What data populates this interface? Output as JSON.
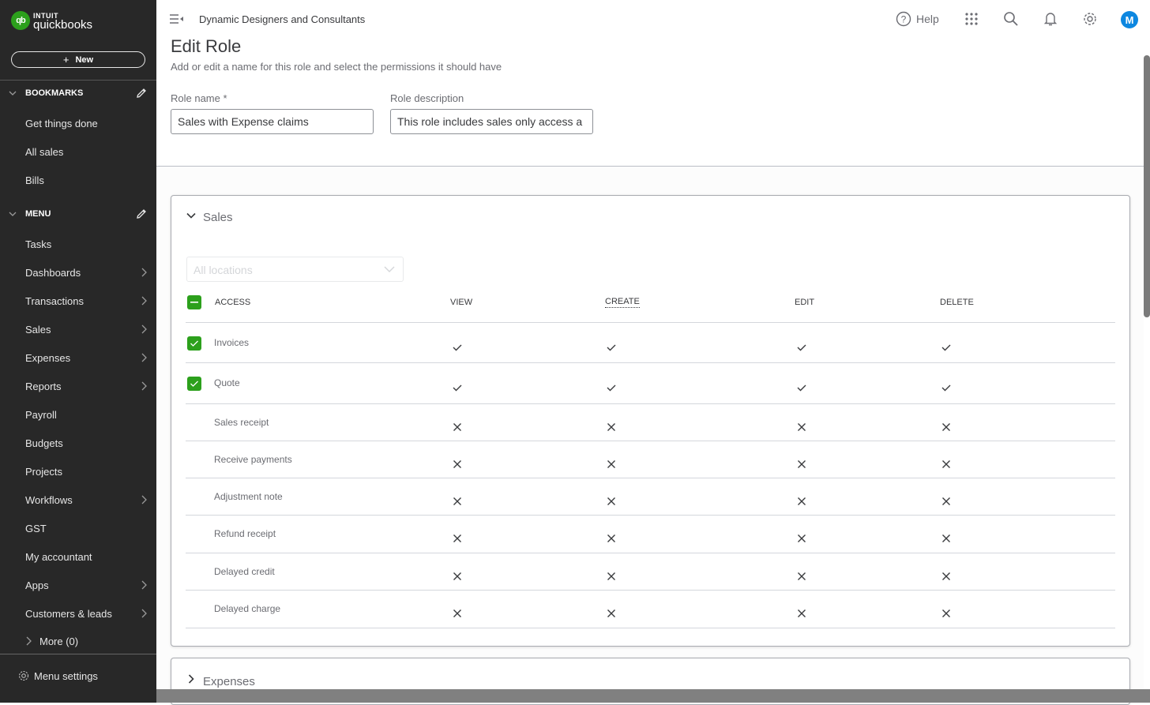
{
  "brand": {
    "intuit": "INTUIT",
    "product": "quickbooks",
    "badge": "qb",
    "color": "#2ca01c"
  },
  "sidebar": {
    "new_label": "New",
    "bookmarks_title": "BOOKMARKS",
    "bookmarks": [
      {
        "label": "Get things done"
      },
      {
        "label": "All sales"
      },
      {
        "label": "Bills"
      }
    ],
    "menu_title": "MENU",
    "menu": [
      {
        "label": "Tasks",
        "has_arrow": false
      },
      {
        "label": "Dashboards",
        "has_arrow": true
      },
      {
        "label": "Transactions",
        "has_arrow": true
      },
      {
        "label": "Sales",
        "has_arrow": true
      },
      {
        "label": "Expenses",
        "has_arrow": true
      },
      {
        "label": "Reports",
        "has_arrow": true
      },
      {
        "label": "Payroll",
        "has_arrow": false
      },
      {
        "label": "Budgets",
        "has_arrow": false
      },
      {
        "label": "Projects",
        "has_arrow": false
      },
      {
        "label": "Workflows",
        "has_arrow": true
      },
      {
        "label": "GST",
        "has_arrow": false
      },
      {
        "label": "My accountant",
        "has_arrow": false
      },
      {
        "label": "Apps",
        "has_arrow": true
      },
      {
        "label": "Customers & leads",
        "has_arrow": true
      }
    ],
    "more_label": "More (0)",
    "menu_settings_label": "Menu settings"
  },
  "topbar": {
    "company": "Dynamic Designers and Consultants",
    "help_label": "Help",
    "avatar_initial": "M",
    "avatar_color": "#0d87e0"
  },
  "page": {
    "title": "Edit Role",
    "subtitle": "Add or edit a name for this role and select the permissions it should have",
    "role_name_label": "Role name *",
    "role_name_value": "Sales with Expense claims",
    "role_desc_label": "Role description",
    "role_desc_value": "This role includes sales only access a"
  },
  "sales_section": {
    "title": "Sales",
    "expanded": true,
    "location_placeholder": "All locations",
    "headers": {
      "access": "ACCESS",
      "view": "VIEW",
      "create": "CREATE",
      "edit": "EDIT",
      "delete": "DELETE"
    },
    "access_all_state": "indeterminate",
    "rows": [
      {
        "name": "Invoices",
        "checked": true,
        "view": true,
        "create": true,
        "edit": true,
        "delete": true
      },
      {
        "name": "Quote",
        "checked": true,
        "view": true,
        "create": true,
        "edit": true,
        "delete": true
      },
      {
        "name": "Sales receipt",
        "checked": false,
        "view": false,
        "create": false,
        "edit": false,
        "delete": false
      },
      {
        "name": "Receive payments",
        "checked": false,
        "view": false,
        "create": false,
        "edit": false,
        "delete": false
      },
      {
        "name": "Adjustment note",
        "checked": false,
        "view": false,
        "create": false,
        "edit": false,
        "delete": false
      },
      {
        "name": "Refund receipt",
        "checked": false,
        "view": false,
        "create": false,
        "edit": false,
        "delete": false
      },
      {
        "name": "Delayed credit",
        "checked": false,
        "view": false,
        "create": false,
        "edit": false,
        "delete": false
      },
      {
        "name": "Delayed charge",
        "checked": false,
        "view": false,
        "create": false,
        "edit": false,
        "delete": false
      }
    ]
  },
  "expenses_section": {
    "title": "Expenses",
    "expanded": false
  }
}
